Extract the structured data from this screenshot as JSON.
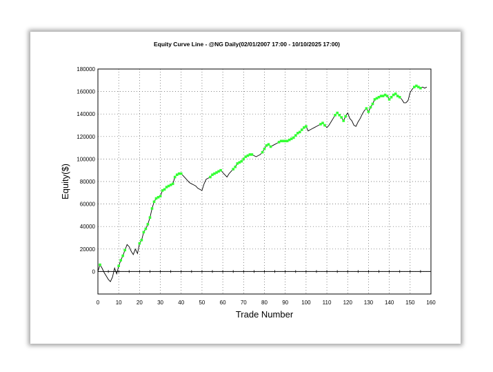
{
  "chart_data": {
    "type": "line",
    "title": "Equity Curve Line - @NG Daily(02/01/2007 17:00 - 10/10/2025 17:00)",
    "xlabel": "Trade Number",
    "ylabel": "Equity($)",
    "xlim": [
      0,
      160
    ],
    "ylim": [
      -20000,
      180000
    ],
    "xticks": [
      "0",
      "10",
      "20",
      "30",
      "40",
      "50",
      "60",
      "70",
      "80",
      "90",
      "100",
      "110",
      "120",
      "130",
      "140",
      "150",
      "160"
    ],
    "yticks": [
      "180000",
      "160000",
      "140000",
      "120000",
      "100000",
      "80000",
      "60000",
      "40000",
      "20000",
      "0"
    ],
    "grid": true,
    "colors": {
      "equity_line": "#000000",
      "new_high_markers": "#33ff33",
      "zero_line": "#000000"
    },
    "series": [
      {
        "x": [
          0,
          1,
          2,
          3,
          4,
          5,
          6,
          7,
          8,
          9,
          10,
          11,
          12,
          13,
          14,
          15,
          16,
          17,
          18,
          19,
          20,
          21,
          22,
          23,
          24,
          25,
          26,
          27,
          28,
          29,
          30,
          31,
          32,
          33,
          34,
          35,
          36,
          37,
          38,
          39,
          40,
          41,
          42,
          43,
          44,
          45,
          46,
          47,
          48,
          49,
          50,
          51,
          52,
          53,
          54,
          55,
          56,
          57,
          58,
          59,
          60,
          61,
          62,
          63,
          64,
          65,
          66,
          67,
          68,
          69,
          70,
          71,
          72,
          73,
          74,
          75,
          76,
          77,
          78,
          79,
          80,
          81,
          82,
          83,
          84,
          85,
          86,
          87,
          88,
          89,
          90,
          91,
          92,
          93,
          94,
          95,
          96,
          97,
          98,
          99,
          100,
          101,
          102,
          103,
          104,
          105,
          106,
          107,
          108,
          109,
          110,
          111,
          112,
          113,
          114,
          115,
          116,
          117,
          118,
          119,
          120,
          121,
          122,
          123,
          124,
          125,
          126,
          127,
          128,
          129,
          130,
          131,
          132,
          133,
          134,
          135,
          136,
          137,
          138,
          139,
          140,
          141,
          142,
          143,
          144,
          145,
          146,
          147,
          148,
          149,
          150,
          151,
          152,
          153,
          154,
          155,
          156,
          157,
          158
        ],
        "values": [
          0,
          6000,
          3000,
          -1000,
          -4000,
          -7000,
          -9000,
          -5000,
          3000,
          -2000,
          5000,
          10000,
          14000,
          19000,
          24000,
          22000,
          18000,
          15000,
          20000,
          16000,
          25000,
          28000,
          35000,
          38000,
          42000,
          48000,
          56000,
          62000,
          65000,
          66000,
          67000,
          72000,
          73000,
          75000,
          76000,
          77000,
          78000,
          84000,
          86000,
          87000,
          87000,
          85000,
          83000,
          81000,
          79000,
          78000,
          77000,
          76000,
          74000,
          73000,
          72000,
          78000,
          82000,
          83000,
          84000,
          86000,
          87000,
          88000,
          89000,
          90000,
          88000,
          86000,
          84000,
          87000,
          89000,
          91000,
          93000,
          96000,
          97000,
          98000,
          100000,
          102000,
          103000,
          104000,
          104000,
          103000,
          102000,
          103000,
          104000,
          106000,
          109000,
          112000,
          113000,
          111000,
          112000,
          113000,
          114000,
          115000,
          116000,
          116000,
          116000,
          116000,
          117000,
          118000,
          119000,
          121000,
          123000,
          124000,
          126000,
          128000,
          129000,
          125000,
          126000,
          127000,
          128000,
          129000,
          130000,
          131000,
          132000,
          130000,
          128000,
          130000,
          133000,
          136000,
          139000,
          141000,
          139000,
          137000,
          134000,
          138000,
          141000,
          136000,
          134000,
          130000,
          129000,
          133000,
          136000,
          140000,
          143000,
          145000,
          142000,
          146000,
          149000,
          153000,
          154000,
          155000,
          156000,
          156000,
          157000,
          156000,
          153000,
          155000,
          157000,
          158000,
          156000,
          155000,
          153000,
          150000,
          150000,
          152000,
          159000,
          162000,
          164000,
          165000,
          164000,
          163000,
          164000,
          163000,
          164000
        ],
        "new_highs": [
          1,
          10,
          11,
          12,
          13,
          20,
          21,
          22,
          23,
          24,
          25,
          26,
          27,
          28,
          29,
          30,
          31,
          32,
          33,
          34,
          35,
          36,
          37,
          38,
          39,
          40,
          54,
          55,
          56,
          57,
          58,
          59,
          65,
          66,
          67,
          68,
          69,
          70,
          71,
          72,
          73,
          74,
          79,
          80,
          81,
          82,
          83,
          87,
          88,
          89,
          90,
          91,
          92,
          93,
          94,
          95,
          96,
          97,
          98,
          99,
          100,
          107,
          108,
          109,
          114,
          115,
          116,
          117,
          118,
          119,
          129,
          130,
          131,
          132,
          133,
          134,
          135,
          136,
          137,
          138,
          139,
          140,
          141,
          142,
          143,
          144,
          145,
          152,
          153,
          154,
          155
        ]
      }
    ]
  }
}
